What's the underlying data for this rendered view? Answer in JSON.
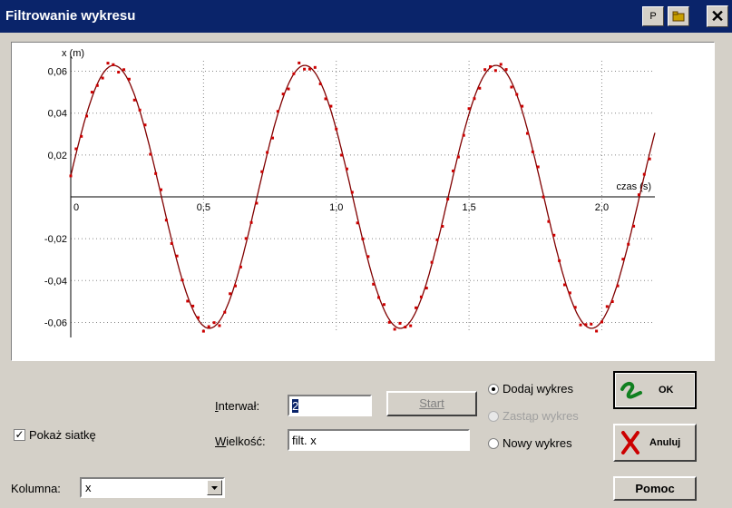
{
  "window": {
    "title": "Filtrowanie wykresu",
    "btn_p": "P",
    "close_glyph": "✕"
  },
  "chart_data": {
    "type": "scatter",
    "title": "",
    "xlabel": "czas (s)",
    "ylabel": "x (m)",
    "xlim": [
      0,
      2.2
    ],
    "ylim": [
      -0.065,
      0.065
    ],
    "x_ticks": [
      0,
      0.5,
      1.0,
      1.5,
      2.0
    ],
    "x_tick_labels": [
      "0",
      "0,5",
      "1,0",
      "1,5",
      "2,0"
    ],
    "y_ticks": [
      0.06,
      0.04,
      0.02,
      -0.02,
      -0.04,
      -0.06
    ],
    "y_tick_labels": [
      "0,06",
      "0,04",
      "0,02",
      "-0,02",
      "-0,04",
      "-0,06"
    ],
    "grid": true,
    "series": [
      {
        "kind": "points",
        "color": "#cc0000",
        "amplitude": 0.062,
        "period": 0.72,
        "phase_offset": 0.01
      },
      {
        "kind": "filtered-line",
        "color": "#800000",
        "amplitude": 0.062,
        "period": 0.72,
        "phase_offset": 0.01
      }
    ]
  },
  "form": {
    "interval_label": "Interwał:",
    "interval_value": "2",
    "quantity_label": "Wielkość:",
    "quantity_value": "filt. x",
    "start_label": "Start",
    "radio_add": "Dodaj wykres",
    "radio_replace": "Zastąp wykres",
    "radio_new": "Nowy wykres",
    "ok_label": "OK",
    "cancel_label": "Anuluj",
    "help_label": "Pomoc",
    "show_grid_label": "Pokaż siatkę",
    "column_label": "Kolumna:",
    "column_value": "x"
  }
}
